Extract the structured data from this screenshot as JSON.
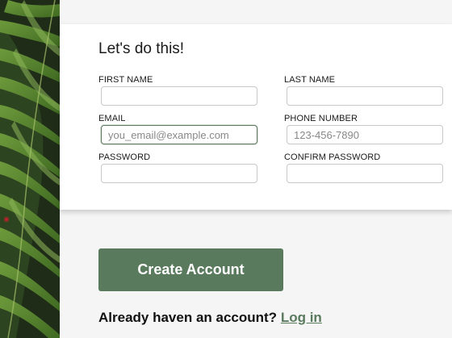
{
  "form": {
    "title": "Let's do this!",
    "fields": {
      "first_name": {
        "label": "FIRST NAME",
        "value": "",
        "placeholder": ""
      },
      "last_name": {
        "label": "LAST NAME",
        "value": "",
        "placeholder": ""
      },
      "email": {
        "label": "EMAIL",
        "value": "",
        "placeholder": "you_email@example.com"
      },
      "phone": {
        "label": "PHONE NUMBER",
        "value": "",
        "placeholder": "123-456-7890"
      },
      "password": {
        "label": "PASSWORD",
        "value": "",
        "placeholder": ""
      },
      "confirm_password": {
        "label": "CONFIRM PASSWORD",
        "value": "",
        "placeholder": ""
      }
    }
  },
  "actions": {
    "create_account_label": "Create Account",
    "login_prompt": "Already haven an account?",
    "login_link": "Log in"
  },
  "colors": {
    "accent": "#5a7a5e",
    "background": "#f5f5f5",
    "card": "#ffffff"
  },
  "decor": {
    "side_image": "fern-leaves"
  }
}
